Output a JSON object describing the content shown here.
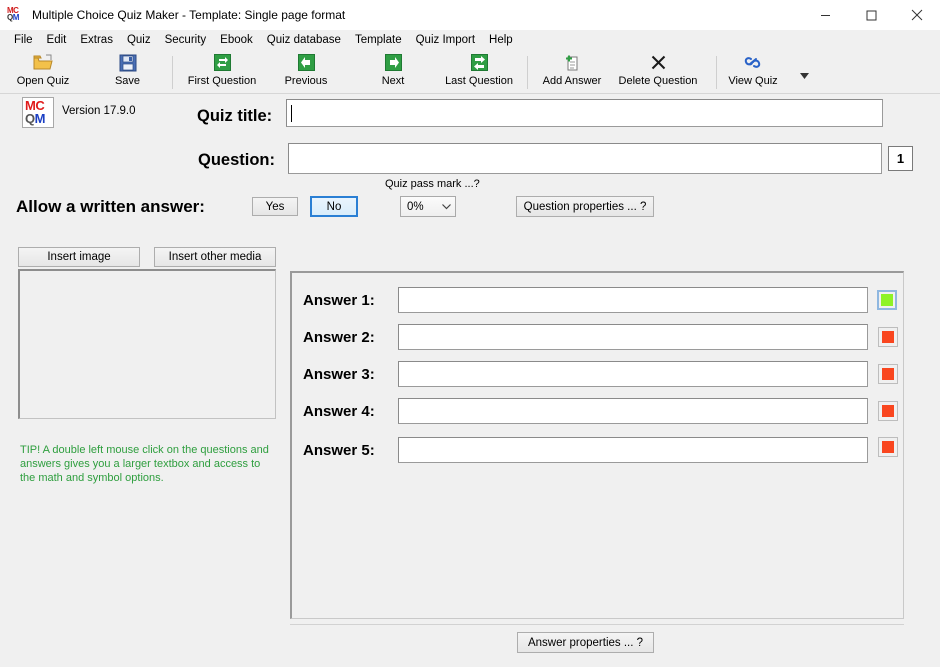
{
  "window": {
    "title": "Multiple Choice Quiz Maker - Template: Single page format",
    "app_icon_top": "MC",
    "app_icon_bottom_q": "Q",
    "app_icon_bottom_m": "M",
    "minimize_label": "minimize-icon",
    "maximize_label": "maximize-icon",
    "close_label": "close-icon"
  },
  "menubar": {
    "items": [
      {
        "label": "File"
      },
      {
        "label": "Edit"
      },
      {
        "label": "Extras"
      },
      {
        "label": "Quiz"
      },
      {
        "label": "Security"
      },
      {
        "label": "Ebook"
      },
      {
        "label": "Quiz database"
      },
      {
        "label": "Template"
      },
      {
        "label": "Quiz Import"
      },
      {
        "label": "Help"
      }
    ]
  },
  "toolbar": {
    "buttons": [
      {
        "label": "Open Quiz",
        "icon": "open-folder-icon"
      },
      {
        "label": "Save",
        "icon": "floppy-disk-icon"
      },
      {
        "label": "First Question",
        "icon": "first-question-icon"
      },
      {
        "label": "Previous",
        "icon": "arrow-left-icon"
      },
      {
        "label": "Next",
        "icon": "arrow-right-icon"
      },
      {
        "label": "Last Question",
        "icon": "last-question-icon"
      },
      {
        "label": "Add Answer",
        "icon": "add-answer-icon"
      },
      {
        "label": "Delete Question",
        "icon": "close-x-icon"
      },
      {
        "label": "View Quiz",
        "icon": "link-chain-icon"
      }
    ],
    "overflow_caret": "chevron-down-icon"
  },
  "branding": {
    "logo_top": "MC",
    "logo_q": "Q",
    "logo_m": "M",
    "version": "Version 17.9.0"
  },
  "form": {
    "quiz_title_label": "Quiz title:",
    "quiz_title_value": "",
    "question_label": "Question:",
    "question_value": "",
    "question_number": "1",
    "allow_written_label": "Allow a written answer:",
    "yes_label": "Yes",
    "no_label": "No",
    "selected_written_answer": "No",
    "pass_mark_label": "Quiz pass mark ...?",
    "pass_mark_value": "0%",
    "pass_mark_chevron": "chevron-down-icon",
    "question_properties_label": "Question properties ... ?"
  },
  "media": {
    "insert_image_label": "Insert image",
    "insert_other_media_label": "Insert other media",
    "tip_text": "TIP! A double left mouse click on the questions and answers gives you a larger textbox and access to the math and symbol options."
  },
  "answers": {
    "rows": [
      {
        "label": "Answer 1:",
        "value": "",
        "swatch_color": "#8ef228",
        "state": "correct",
        "focused": true
      },
      {
        "label": "Answer 2:",
        "value": "",
        "swatch_color": "#f9461f",
        "state": "incorrect",
        "focused": false
      },
      {
        "label": "Answer 3:",
        "value": "",
        "swatch_color": "#f9461f",
        "state": "incorrect",
        "focused": false
      },
      {
        "label": "Answer 4:",
        "value": "",
        "swatch_color": "#f9461f",
        "state": "incorrect",
        "focused": false
      },
      {
        "label": "Answer 5:",
        "value": "",
        "swatch_color": "#f9461f",
        "state": "incorrect",
        "focused": false
      }
    ],
    "answer_properties_label": "Answer properties ... ?"
  },
  "colors": {
    "window_bg": "#f0f0f0",
    "titlebar_bg": "#ffffff",
    "accent_selected": "#2a7fd4",
    "tip_green": "#2e9e3e",
    "correct_green": "#8ef228",
    "incorrect_red": "#f9461f"
  }
}
